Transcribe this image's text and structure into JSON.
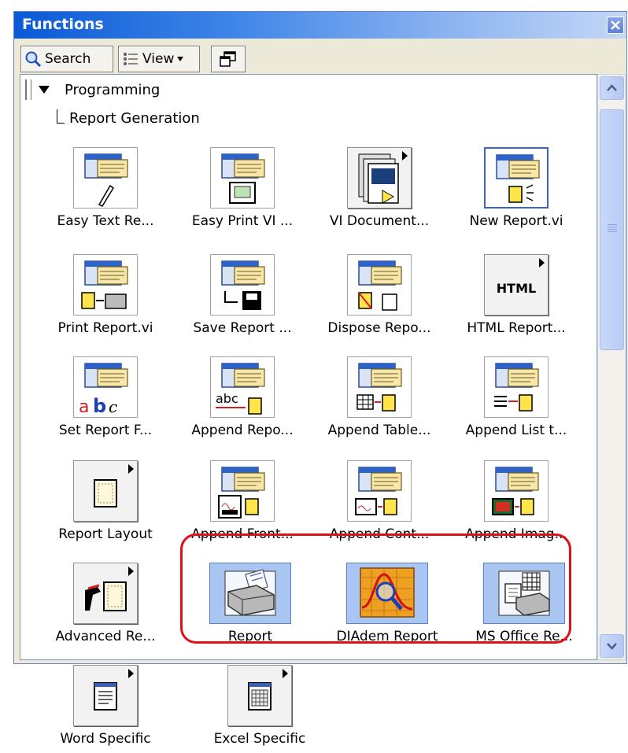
{
  "window": {
    "title": "Functions"
  },
  "toolbar": {
    "search_label": "Search",
    "view_label": "View"
  },
  "tree": {
    "level1": "Programming",
    "level2": "Report Generation"
  },
  "items": [
    {
      "label": "Easy Text Re...",
      "icon": "report-pencil-icon",
      "kind": "vi"
    },
    {
      "label": "Easy Print VI ...",
      "icon": "report-print-vi-icon",
      "kind": "vi"
    },
    {
      "label": "VI Document...",
      "icon": "vi-document-icon",
      "kind": "subpalette"
    },
    {
      "label": "New Report.vi",
      "icon": "new-report-icon",
      "kind": "vi-selected"
    },
    {
      "label": "Print Report.vi",
      "icon": "print-report-icon",
      "kind": "vi"
    },
    {
      "label": "Save Report ...",
      "icon": "save-report-icon",
      "kind": "vi"
    },
    {
      "label": "Dispose Repo...",
      "icon": "dispose-report-icon",
      "kind": "vi"
    },
    {
      "label": "HTML Report...",
      "icon": "html-report-icon",
      "kind": "subpalette",
      "glyph": "HTML"
    },
    {
      "label": "Set Report F...",
      "icon": "set-report-font-icon",
      "kind": "vi"
    },
    {
      "label": "Append Repo...",
      "icon": "append-report-text-icon",
      "kind": "vi"
    },
    {
      "label": "Append Table...",
      "icon": "append-table-icon",
      "kind": "vi"
    },
    {
      "label": "Append List t...",
      "icon": "append-list-icon",
      "kind": "vi"
    },
    {
      "label": "Report Layout",
      "icon": "report-layout-icon",
      "kind": "subpalette"
    },
    {
      "label": "Append Front...",
      "icon": "append-front-panel-icon",
      "kind": "vi"
    },
    {
      "label": "Append Cont...",
      "icon": "append-control-image-icon",
      "kind": "vi"
    },
    {
      "label": "Append Imag...",
      "icon": "append-image-icon",
      "kind": "vi"
    },
    {
      "label": "Advanced Re...",
      "icon": "advanced-report-icon",
      "kind": "subpalette"
    },
    {
      "label": "Report",
      "icon": "report-printer-icon",
      "kind": "express"
    },
    {
      "label": "DIAdem Report",
      "icon": "diadem-report-icon",
      "kind": "express"
    },
    {
      "label": "MS Office Re...",
      "icon": "ms-office-report-icon",
      "kind": "express"
    },
    {
      "label": "Word Specific",
      "icon": "word-specific-icon",
      "kind": "subpalette"
    },
    {
      "label": "Excel Specific",
      "icon": "excel-specific-icon",
      "kind": "subpalette"
    }
  ],
  "colors": {
    "highlight": "#e0101a",
    "titlebar": "#0a5ad6",
    "express_tile": "#a9c6f2"
  }
}
